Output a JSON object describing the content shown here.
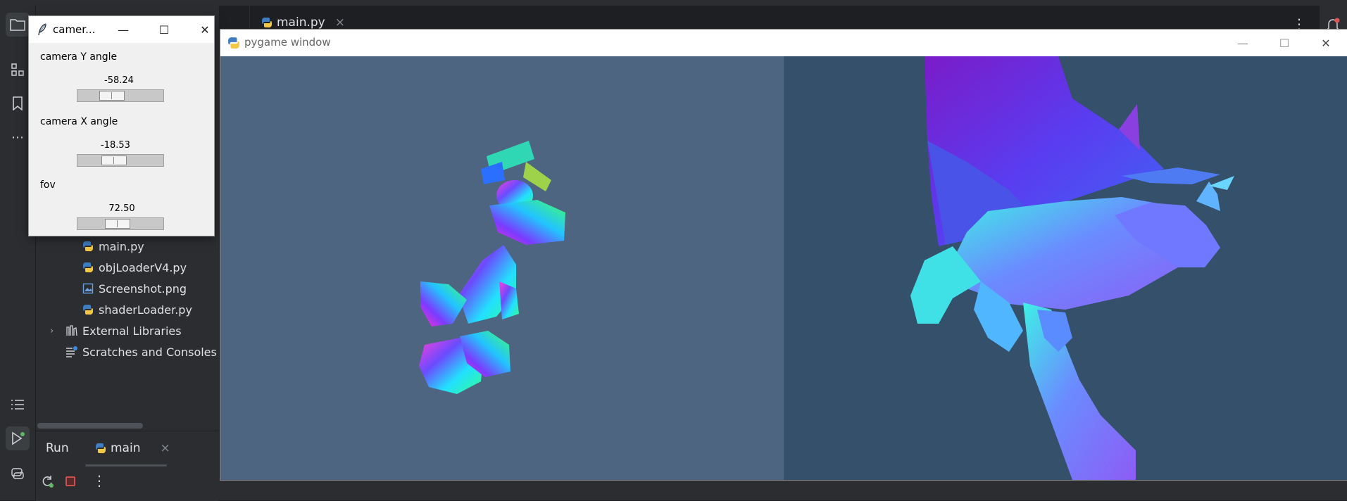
{
  "ide": {
    "editor_tab": {
      "label": "main.py",
      "close": "×"
    },
    "project_tree": [
      {
        "label": "main.py",
        "icon": "python-file-icon"
      },
      {
        "label": "objLoaderV4.py",
        "icon": "python-file-icon"
      },
      {
        "label": "Screenshot.png",
        "icon": "image-file-icon"
      },
      {
        "label": "shaderLoader.py",
        "icon": "python-file-icon"
      },
      {
        "label": "External Libraries",
        "icon": "library-icon"
      },
      {
        "label": "Scratches and Consoles",
        "icon": "scratches-icon"
      }
    ],
    "run_panel": {
      "title": "Run",
      "tab_label": "main",
      "tab_close": "×"
    },
    "colors": {
      "background": "#1e1f22",
      "panel": "#2b2d30",
      "stop": "#c94f4f",
      "run_active": "#5fb865"
    }
  },
  "tk_window": {
    "title": "camer...",
    "controls": {
      "minimize": "—",
      "maximize": "☐",
      "close": "✕"
    },
    "sliders": [
      {
        "label": "camera Y angle",
        "value_text": "-58.24",
        "fraction": 0.36
      },
      {
        "label": "camera X angle",
        "value_text": "-18.53",
        "fraction": 0.39
      },
      {
        "label": "fov",
        "value_text": "72.50",
        "fraction": 0.45
      }
    ]
  },
  "pygame_window": {
    "title": "pygame window",
    "controls": {
      "minimize": "—",
      "maximize": "☐",
      "close": "✕"
    },
    "colors": {
      "left_viewport": "#4d6581",
      "right_viewport": "#34506b"
    }
  }
}
